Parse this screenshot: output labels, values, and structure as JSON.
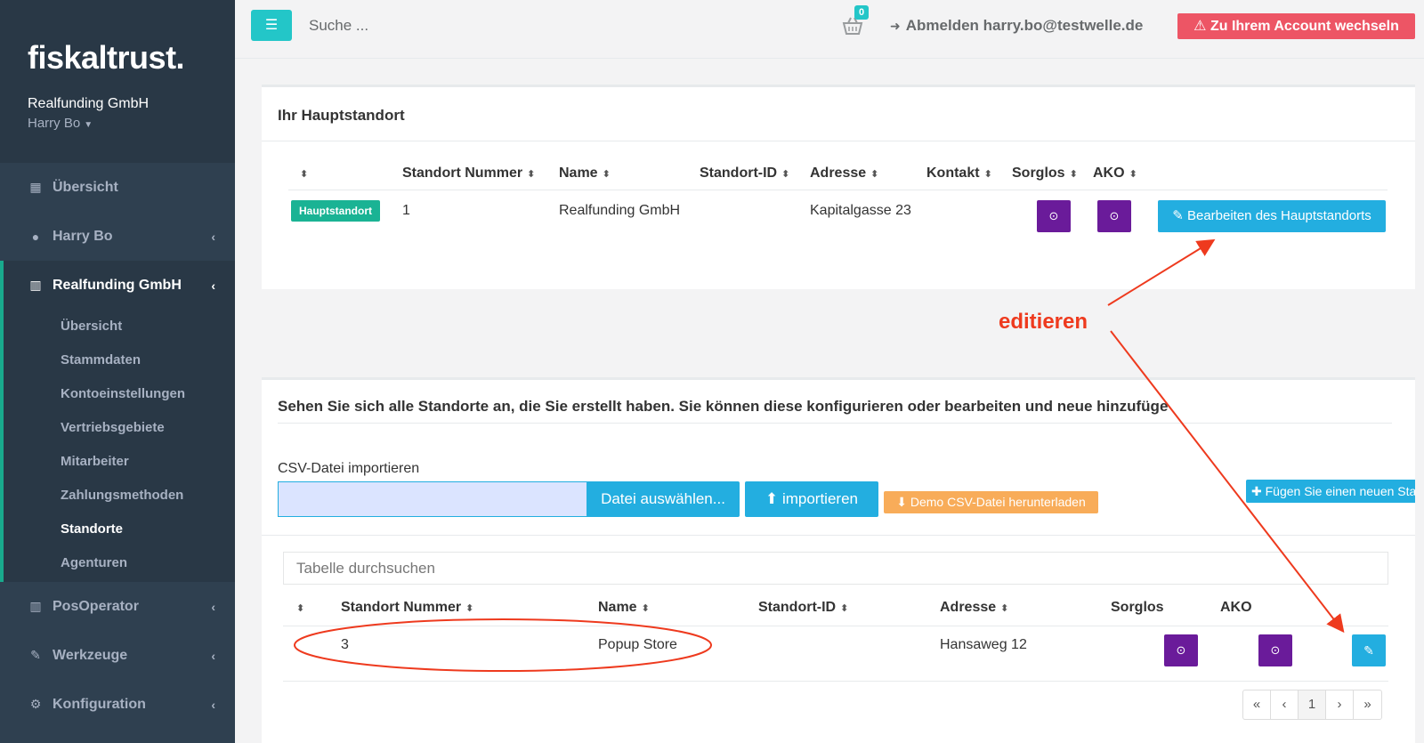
{
  "sidebar": {
    "logo": "fiskaltrust.",
    "company": "Realfunding GmbH",
    "user": "Harry Bo",
    "nav": [
      {
        "label": "Übersicht",
        "icon": "grid-icon"
      },
      {
        "label": "Harry Bo",
        "icon": "user-icon"
      },
      {
        "label": "Realfunding GmbH",
        "icon": "building-icon"
      },
      {
        "label": "PosOperator",
        "icon": "building-icon"
      },
      {
        "label": "Werkzeuge",
        "icon": "wrench-icon"
      },
      {
        "label": "Konfiguration",
        "icon": "cogs-icon"
      }
    ],
    "sub": [
      "Übersicht",
      "Stammdaten",
      "Kontoeinstellungen",
      "Vertriebsgebiete",
      "Mitarbeiter",
      "Zahlungsmethoden",
      "Standorte",
      "Agenturen"
    ]
  },
  "topbar": {
    "search_placeholder": "Suche ...",
    "cart_count": "0",
    "logout": "Abmelden harry.bo@testwelle.de",
    "switch": "Zu Ihrem Account wechseln"
  },
  "main_location": {
    "title": "Ihr Hauptstandort",
    "headers": [
      "Standort Nummer",
      "Name",
      "Standort-ID",
      "Adresse",
      "Kontakt",
      "Sorglos",
      "AKO"
    ],
    "badge": "Hauptstandort",
    "row": {
      "number": "1",
      "name": "Realfunding GmbH",
      "id": "",
      "address": "Kapitalgasse 23"
    },
    "edit_button": "Bearbeiten des Hauptstandorts"
  },
  "locations": {
    "title": "Sehen Sie sich alle Standorte an, die Sie erstellt haben. Sie können diese konfigurieren oder bearbeiten und neue hinzufügen.",
    "csv_label": "CSV-Datei importieren",
    "choose_file": "Datei auswählen...",
    "import": "importieren",
    "demo_csv": "Demo CSV-Datei herunterladen",
    "add_new": "Fügen Sie einen neuen Standort hinzu",
    "table_search_placeholder": "Tabelle durchsuchen",
    "headers": [
      "Standort Nummer",
      "Name",
      "Standort-ID",
      "Adresse",
      "Sorglos",
      "AKO"
    ],
    "rows": [
      {
        "number": "3",
        "name": "Popup Store",
        "id": "",
        "address": "Hansaweg 12"
      }
    ],
    "pagination": [
      "«",
      "‹",
      "1",
      "›",
      "»"
    ]
  },
  "annotation": {
    "text": "editieren",
    "color": "#ee3a1e"
  }
}
